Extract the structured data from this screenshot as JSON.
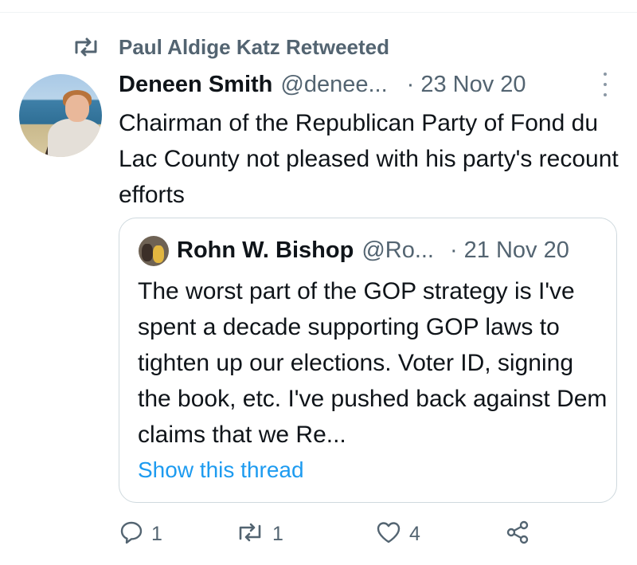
{
  "retweet_banner": {
    "icon": "retweet-icon",
    "label": "Paul Aldige Katz Retweeted"
  },
  "tweet": {
    "author_name": "Deneen Smith",
    "author_handle": "@denee...",
    "separator": "·",
    "date": "23 Nov 20",
    "more_icon": "more-vertical-icon",
    "text": "Chairman of the Republican Party of Fond du Lac County not pleased with his party's recount efforts"
  },
  "quoted_tweet": {
    "author_name": "Rohn W. Bishop",
    "author_handle": "@Ro...",
    "separator": "·",
    "date": "21 Nov 20",
    "text": "The worst part of the GOP strategy is I've spent a decade supporting GOP laws to tighten up our elections. Voter ID, signing the book, etc.  I've pushed back against Dem claims that we Re...",
    "show_thread_label": "Show this thread"
  },
  "actions": {
    "reply": {
      "icon": "reply-icon",
      "count": "1"
    },
    "retweet": {
      "icon": "retweet-icon",
      "count": "1"
    },
    "like": {
      "icon": "heart-icon",
      "count": "4"
    },
    "share": {
      "icon": "share-icon"
    }
  },
  "colors": {
    "text_primary": "#0f1419",
    "text_secondary": "#536471",
    "link_blue": "#1d9bf0",
    "border": "#cfd9de"
  }
}
